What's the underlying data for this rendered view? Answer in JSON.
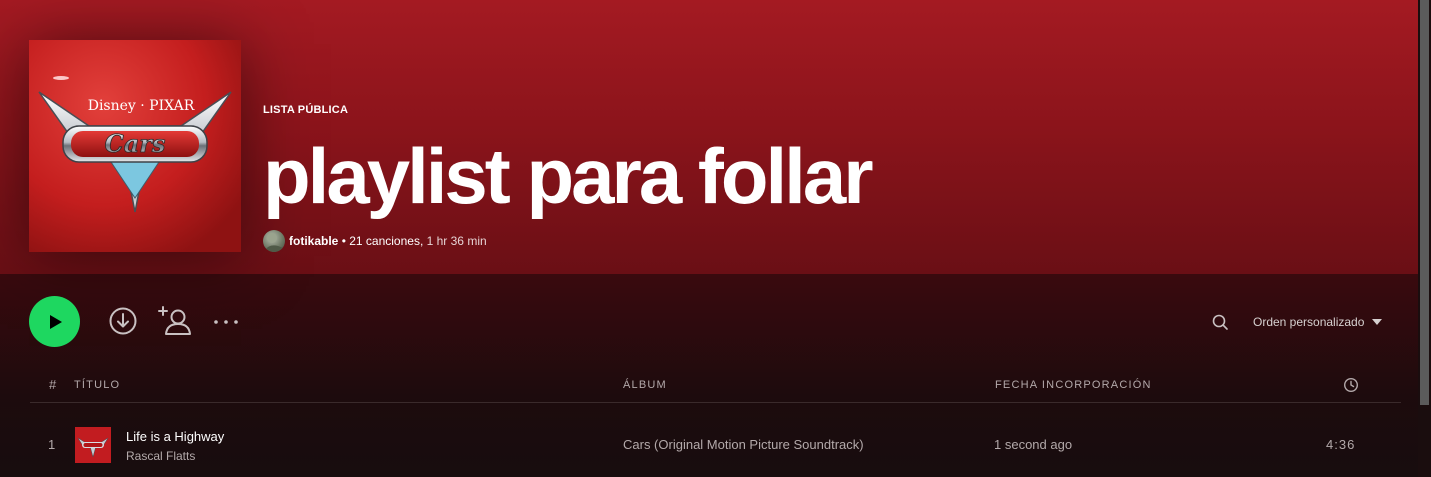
{
  "playlist": {
    "type_label": "LISTA PÚBLICA",
    "title": "playlist para follar",
    "owner": "fotikable",
    "song_count": "• 21 canciones,",
    "duration": "1 hr 36 min",
    "cover": {
      "brand": "Disney · PIXAR",
      "logo_text": "Cars"
    }
  },
  "actions": {
    "play_icon": "play-icon",
    "download_icon": "download-circle-icon",
    "add_user_icon": "add-user-icon",
    "more_icon": "ellipsis-icon",
    "search_icon": "search-icon",
    "sort_label": "Orden personalizado",
    "sort_icon": "caret-down-icon"
  },
  "table": {
    "headers": {
      "index": "#",
      "title": "TÍTULO",
      "album": "ÁLBUM",
      "date_added": "FECHA INCORPORACIÓN",
      "duration_icon": "clock-icon"
    },
    "rows": [
      {
        "index": "1",
        "title": "Life is a Highway",
        "artist": "Rascal Flatts",
        "album": "Cars (Original Motion Picture Soundtrack)",
        "added": "1 second ago",
        "duration": "4:36"
      }
    ]
  },
  "colors": {
    "accent_green": "#1ed760",
    "hero_red": "#a41a22",
    "background": "#121212"
  }
}
